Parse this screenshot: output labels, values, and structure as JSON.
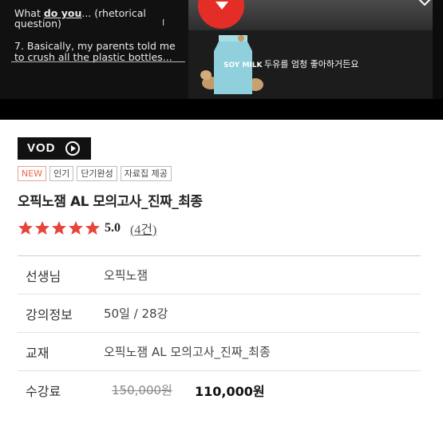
{
  "video": {
    "subtitle_line1_pre": "What ",
    "subtitle_line1_bold": "do you",
    "subtitle_line1_post": "... (rhetorical",
    "subtitle_line2": "question)",
    "subtitle_line3": "7. Basically, my parents told me",
    "subtitle_line4": "to crush all the plastic bottles...",
    "soy_caption": "두유를 엄청 좋아하거든요",
    "carton_text": "SOY MILK",
    "accent": "#e52d27"
  },
  "badge": {
    "label": "VOD"
  },
  "tags": [
    "NEW",
    "인기",
    "단기완성",
    "자료집 제공"
  ],
  "product": {
    "title": "오픽노잼 AL 모의고사_진짜_최종"
  },
  "rating": {
    "stars": 5,
    "score": "5.0",
    "count": "(4건)",
    "star_color": "#e8443a"
  },
  "info": {
    "teacher_label": "선생님",
    "teacher_value": "오픽노잼",
    "course_label": "강의정보",
    "course_value": "50일 / 28강",
    "textbook_label": "교재",
    "textbook_value": "오픽노잼 AL 모의고사_진짜_최종",
    "fee_label": "수강료",
    "fee_original": "150,000원",
    "fee_sale": "110,000원"
  }
}
